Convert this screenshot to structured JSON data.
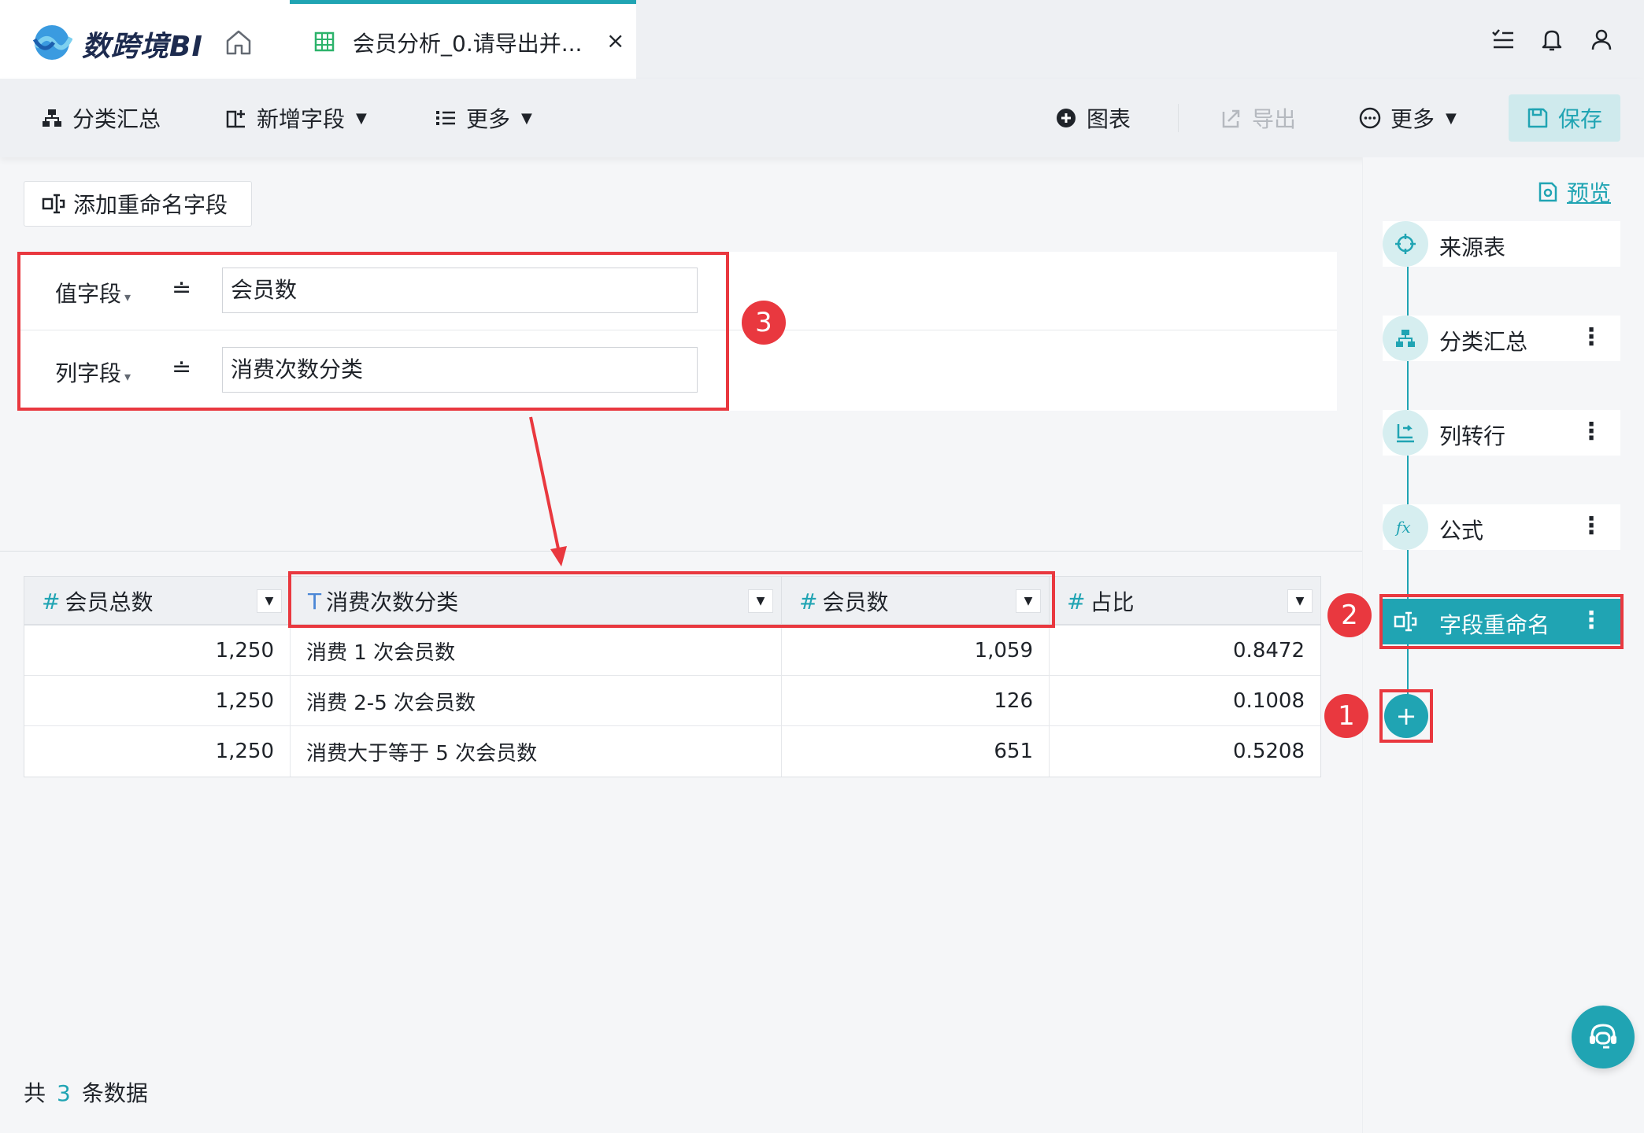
{
  "app": {
    "logo_text": "数跨境BI",
    "tab_title": "会员分析_0.请导出并...",
    "tab_close": "×"
  },
  "toolbar": {
    "classify_summary": "分类汇总",
    "add_field": "新增字段",
    "more_left": "更多",
    "chart": "图表",
    "export": "导出",
    "more_right": "更多",
    "save": "保存",
    "caret": "▼"
  },
  "editor": {
    "add_rename_field": "添加重命名字段",
    "rows": [
      {
        "label": "值字段",
        "eq": "≐",
        "value": "会员数"
      },
      {
        "label": "列字段",
        "eq": "≐",
        "value": "消费次数分类"
      }
    ],
    "dropdown_glyph": "▾"
  },
  "table": {
    "columns": [
      {
        "type": "#",
        "name": "会员总数"
      },
      {
        "type": "T",
        "name": "消费次数分类"
      },
      {
        "type": "#",
        "name": "会员数"
      },
      {
        "type": "#",
        "name": "占比"
      }
    ],
    "menu_glyph": "▼",
    "rows": [
      [
        "1,250",
        "消费 1 次会员数",
        "1,059",
        "0.8472"
      ],
      [
        "1,250",
        "消费 2-5 次会员数",
        "126",
        "0.1008"
      ],
      [
        "1,250",
        "消费大于等于 5 次会员数",
        "651",
        "0.5208"
      ]
    ]
  },
  "footer": {
    "prefix": "共",
    "count": "3",
    "suffix": "条数据"
  },
  "flow": {
    "preview": "预览",
    "nodes": [
      {
        "label": "来源表",
        "has_more": false
      },
      {
        "label": "分类汇总",
        "has_more": true
      },
      {
        "label": "列转行",
        "has_more": true
      },
      {
        "label": "公式",
        "has_more": true
      },
      {
        "label": "字段重命名",
        "has_more": true,
        "active": true
      }
    ],
    "more_glyph": "⋮",
    "add_glyph": "+"
  },
  "annotations": {
    "badge1": "1",
    "badge2": "2",
    "badge3": "3"
  },
  "colors": {
    "accent": "#20a4b3",
    "annotation": "#e9383f"
  }
}
